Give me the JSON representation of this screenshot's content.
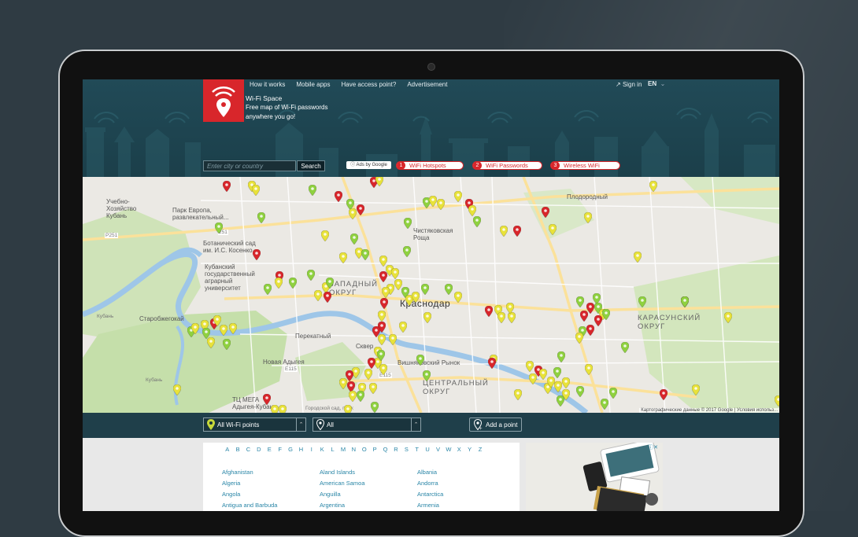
{
  "nav": {
    "items": [
      "How it works",
      "Mobile apps",
      "Have access point?",
      "Advertisement"
    ],
    "signin": "Sign in",
    "lang": "EN"
  },
  "brand": {
    "name": "Wi-Fi Space",
    "tagline_1": "Free map of Wi-Fi passwords",
    "tagline_2": "anywhere you go!"
  },
  "search": {
    "placeholder": "Enter city or country",
    "button": "Search"
  },
  "ads": {
    "label": "Ads by Google",
    "links": [
      {
        "num": "1",
        "label": "WiFi Hotspots"
      },
      {
        "num": "2",
        "label": "WiFi Passwords"
      },
      {
        "num": "3",
        "label": "Wireless WiFi"
      }
    ]
  },
  "map": {
    "labels": {
      "city": "Краснодар",
      "west_district": "ЗАПАДНЫЙ",
      "west_district_2": "ОКРУГ",
      "karasun": "КАРАСУНСКИЙ",
      "karasun_2": "ОКРУГ",
      "central": "ЦЕНТРАЛЬНЫЙ",
      "central_2": "ОКРУГ",
      "park_europe": "Парк Европа,",
      "park_europe_2": "развлекательный...",
      "botanic": "Ботанический сад",
      "botanic_2": "им. И.С. Косенко",
      "kuban_uni": "Кубанский",
      "kuban_uni_2": "государственный",
      "kuban_uni_3": "аграрный",
      "kuban_uni_4": "университет",
      "chistyak": "Чистяковская",
      "chistyak_2": "Роща",
      "plodorod": "Плодородный",
      "starokorsun": "Старобжегокай",
      "perekatny": "Перекатный",
      "novaya": "Новая Адыгея",
      "vishnyak": "Вишняковский Рынок",
      "sqr": "Сквер",
      "tc_mega": "ТЦ МЕГА",
      "tc_mega_2": "Адыгея-Кубань",
      "city_garden": "Городской сад, парк",
      "uchkhoz": "Учебно-",
      "uchkhoz_2": "Хозяйство",
      "uchkhoz_3": "Кубань",
      "kuban_river": "Кубань",
      "kuban_river_2": "Кубань",
      "r251": "P251",
      "r251b": "251",
      "e115": "E115",
      "e115b": "E115"
    },
    "copyright": "Картографические данные © 2017 Google | Условия использ..."
  },
  "filters": {
    "points": "All Wi-Fi points",
    "category": "All",
    "add_point": "Add a point"
  },
  "alphabet": [
    "A",
    "B",
    "C",
    "D",
    "E",
    "F",
    "G",
    "H",
    "I",
    "K",
    "L",
    "M",
    "N",
    "O",
    "P",
    "Q",
    "R",
    "S",
    "T",
    "U",
    "V",
    "W",
    "X",
    "Y",
    "Z"
  ],
  "countries": {
    "col1": [
      "Afghanistan",
      "Algeria",
      "Angola",
      "Antigua and Barbuda"
    ],
    "col2": [
      "Aland Islands",
      "American Samoa",
      "Anguilla",
      "Argentina"
    ],
    "col3": [
      "Albania",
      "Andorra",
      "Antarctica",
      "Armenia"
    ]
  },
  "colors": {
    "brand_red": "#d8262b",
    "header_teal": "#214a57",
    "pin_red": "#d8262b",
    "pin_yellow": "#e8e23a",
    "pin_green": "#8fd13f"
  }
}
